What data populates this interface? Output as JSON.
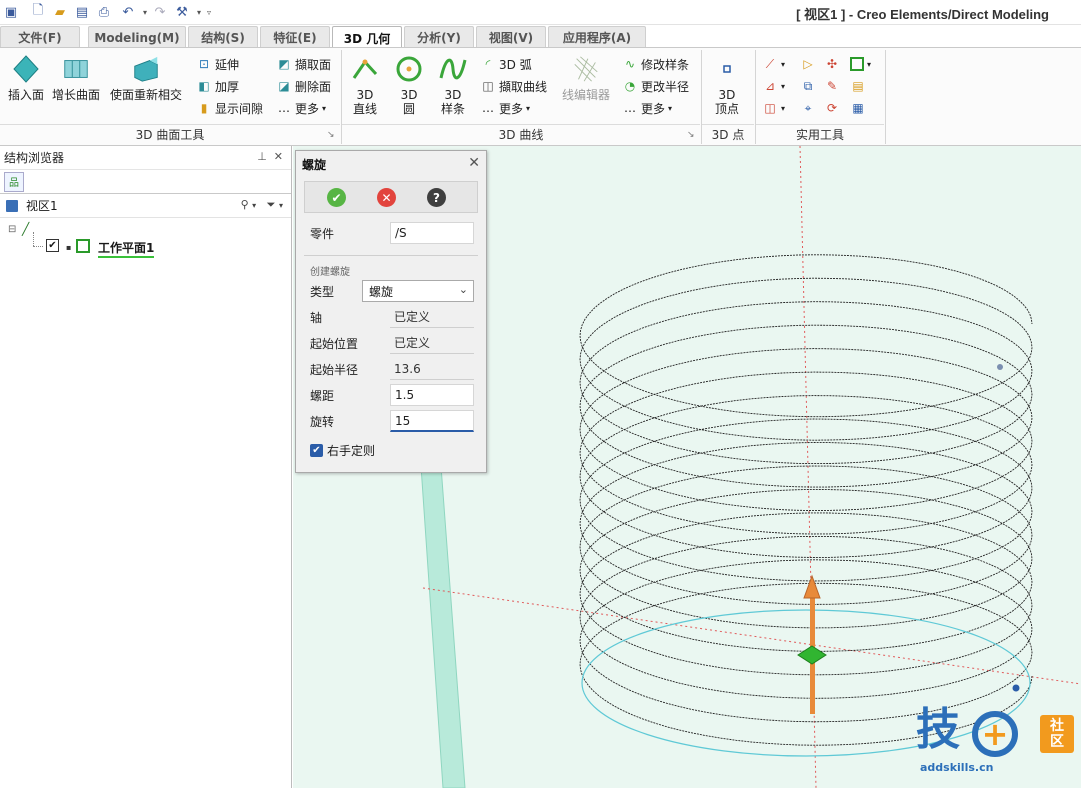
{
  "window": {
    "title": "[ 视区1 ] - Creo Elements/Direct Modeling"
  },
  "tabs": [
    {
      "label": "文件(F)"
    },
    {
      "label": "Modeling(M)"
    },
    {
      "label": "结构(S)"
    },
    {
      "label": "特征(E)"
    },
    {
      "label": "3D 几何"
    },
    {
      "label": "分析(Y)"
    },
    {
      "label": "视图(V)"
    },
    {
      "label": "应用程序(A)"
    }
  ],
  "ribbon": {
    "surface_tools": {
      "label": "3D 曲面工具",
      "insert_face": "插入面",
      "grow_surface": "增长曲面",
      "reintersect": "使面重新相交",
      "extend": "延伸",
      "thicken": "加厚",
      "show_gap": "显示间隙",
      "extract_face": "擷取面",
      "delete_face": "删除面",
      "more": "更多"
    },
    "curves": {
      "label": "3D 曲线",
      "line": "3D\n直线",
      "circle": "3D\n圆",
      "spline": "3D\n样条",
      "arc": "3D 弧",
      "extract_curve": "擷取曲线",
      "more": "更多",
      "wire_editor": "线编辑器",
      "modify_spline": "修改样条",
      "change_radius": "更改半径",
      "more2": "更多"
    },
    "point": {
      "label": "3D 点",
      "vertex": "3D\n顶点"
    },
    "utilities": {
      "label": "实用工具"
    }
  },
  "browser": {
    "title": "结构浏览器",
    "view_name": "视区1",
    "workplane": "工作平面1"
  },
  "dialog": {
    "title": "螺旋",
    "part_label": "零件",
    "part_value": "/S",
    "section": "创建螺旋",
    "type_label": "类型",
    "type_value": "螺旋",
    "axis_label": "轴",
    "axis_value": "已定义",
    "start_label": "起始位置",
    "start_value": "已定义",
    "radius_label": "起始半径",
    "radius_value": "13.6",
    "pitch_label": "螺距",
    "pitch_value": "1.5",
    "turns_label": "旋转",
    "turns_value": "15",
    "right_hand": "右手定则"
  },
  "watermark": {
    "brand": "技",
    "badge": "社区",
    "url": "addskills.cn"
  },
  "colors": {
    "accent": "#2a5ca8",
    "ok": "#57b544",
    "cancel": "#e2443d",
    "help": "#3f3f3f",
    "viewport_bg": "#eaf7f1",
    "workplane": "#b8eada",
    "helix": "#222222",
    "base_circle": "#5fc9d6",
    "arrow": "#e88a3a",
    "point": "#31b531",
    "watermark_blue": "#2c6fb9",
    "watermark_orange": "#f29a1e"
  }
}
